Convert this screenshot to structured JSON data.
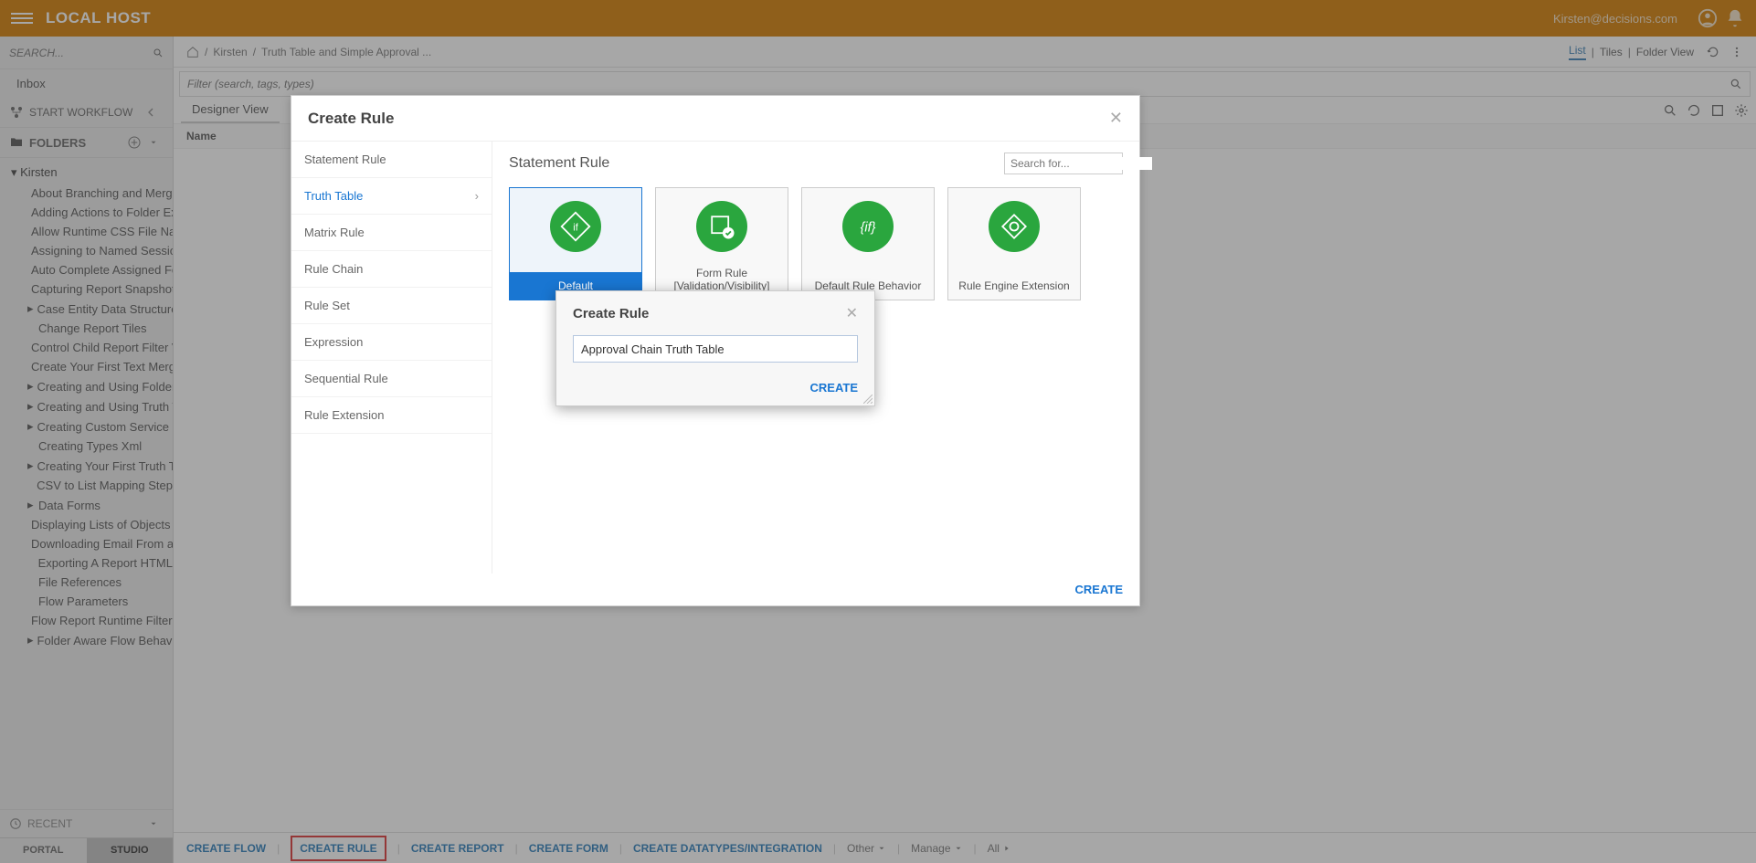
{
  "header": {
    "brand": "LOCAL HOST",
    "user": "Kirsten@decisions.com"
  },
  "sidebar": {
    "search_placeholder": "SEARCH...",
    "inbox": "Inbox",
    "start_workflow": "START WORKFLOW",
    "folders_label": "FOLDERS",
    "tree_root": "Kirsten",
    "tree_items": [
      {
        "label": "About Branching and Merging Fl",
        "caret": false
      },
      {
        "label": "Adding Actions to Folder Extens",
        "caret": false
      },
      {
        "label": "Allow Runtime CSS File Name",
        "caret": false
      },
      {
        "label": "Assigning to Named Sessions",
        "caret": false
      },
      {
        "label": "Auto Complete Assigned Form",
        "caret": false
      },
      {
        "label": "Capturing Report Snapshot",
        "caret": false
      },
      {
        "label": "Case Entity Data Structure",
        "caret": true
      },
      {
        "label": "Change Report Tiles",
        "caret": false
      },
      {
        "label": "Control Child Report Filter Value",
        "caret": false
      },
      {
        "label": "Create Your First Text Merge",
        "caret": false
      },
      {
        "label": "Creating and Using Folder Exten",
        "caret": true
      },
      {
        "label": "Creating and Using Truth Tables",
        "caret": true
      },
      {
        "label": "Creating Custom Service Catalo",
        "caret": true
      },
      {
        "label": "Creating Types Xml",
        "caret": false
      },
      {
        "label": "Creating Your First Truth Table",
        "caret": true
      },
      {
        "label": "CSV to List Mapping Step",
        "caret": false
      },
      {
        "label": "Data Forms",
        "caret": true
      },
      {
        "label": "Displaying Lists of Objects In A",
        "caret": false
      },
      {
        "label": "Downloading Email From a Mail",
        "caret": false
      },
      {
        "label": "Exporting A Report HTML",
        "caret": false
      },
      {
        "label": "File References",
        "caret": false
      },
      {
        "label": "Flow Parameters",
        "caret": false
      },
      {
        "label": "Flow Report Runtime Filters",
        "caret": false
      },
      {
        "label": "Folder Aware Flow Behavior",
        "caret": true
      }
    ],
    "recent": "RECENT",
    "tab_portal": "PORTAL",
    "tab_studio": "STUDIO"
  },
  "breadcrumb": {
    "items": [
      "Kirsten",
      "Truth Table and Simple Approval ..."
    ],
    "view_list": "List",
    "view_tiles": "Tiles",
    "view_folder": "Folder View"
  },
  "main": {
    "filter_placeholder": "Filter (search, tags, types)",
    "designer_view": "Designer View",
    "col_name": "Name"
  },
  "actionbar": {
    "create_flow": "CREATE FLOW",
    "create_rule": "CREATE RULE",
    "create_report": "CREATE REPORT",
    "create_form": "CREATE FORM",
    "create_datatypes": "CREATE DATATYPES/INTEGRATION",
    "other": "Other",
    "manage": "Manage",
    "all": "All"
  },
  "big_modal": {
    "title": "Create Rule",
    "types": [
      "Statement Rule",
      "Truth Table",
      "Matrix Rule",
      "Rule Chain",
      "Rule Set",
      "Expression",
      "Sequential Rule",
      "Rule Extension"
    ],
    "panel_title": "Statement Rule",
    "search_placeholder": "Search for...",
    "cards": [
      {
        "label": "Default"
      },
      {
        "label": "Form Rule [Validation/Visibility]"
      },
      {
        "label": "Default Rule Behavior"
      },
      {
        "label": "Rule Engine Extension"
      }
    ],
    "create": "CREATE"
  },
  "small_modal": {
    "title": "Create Rule",
    "input_value": "Approval Chain Truth Table",
    "create": "CREATE"
  }
}
